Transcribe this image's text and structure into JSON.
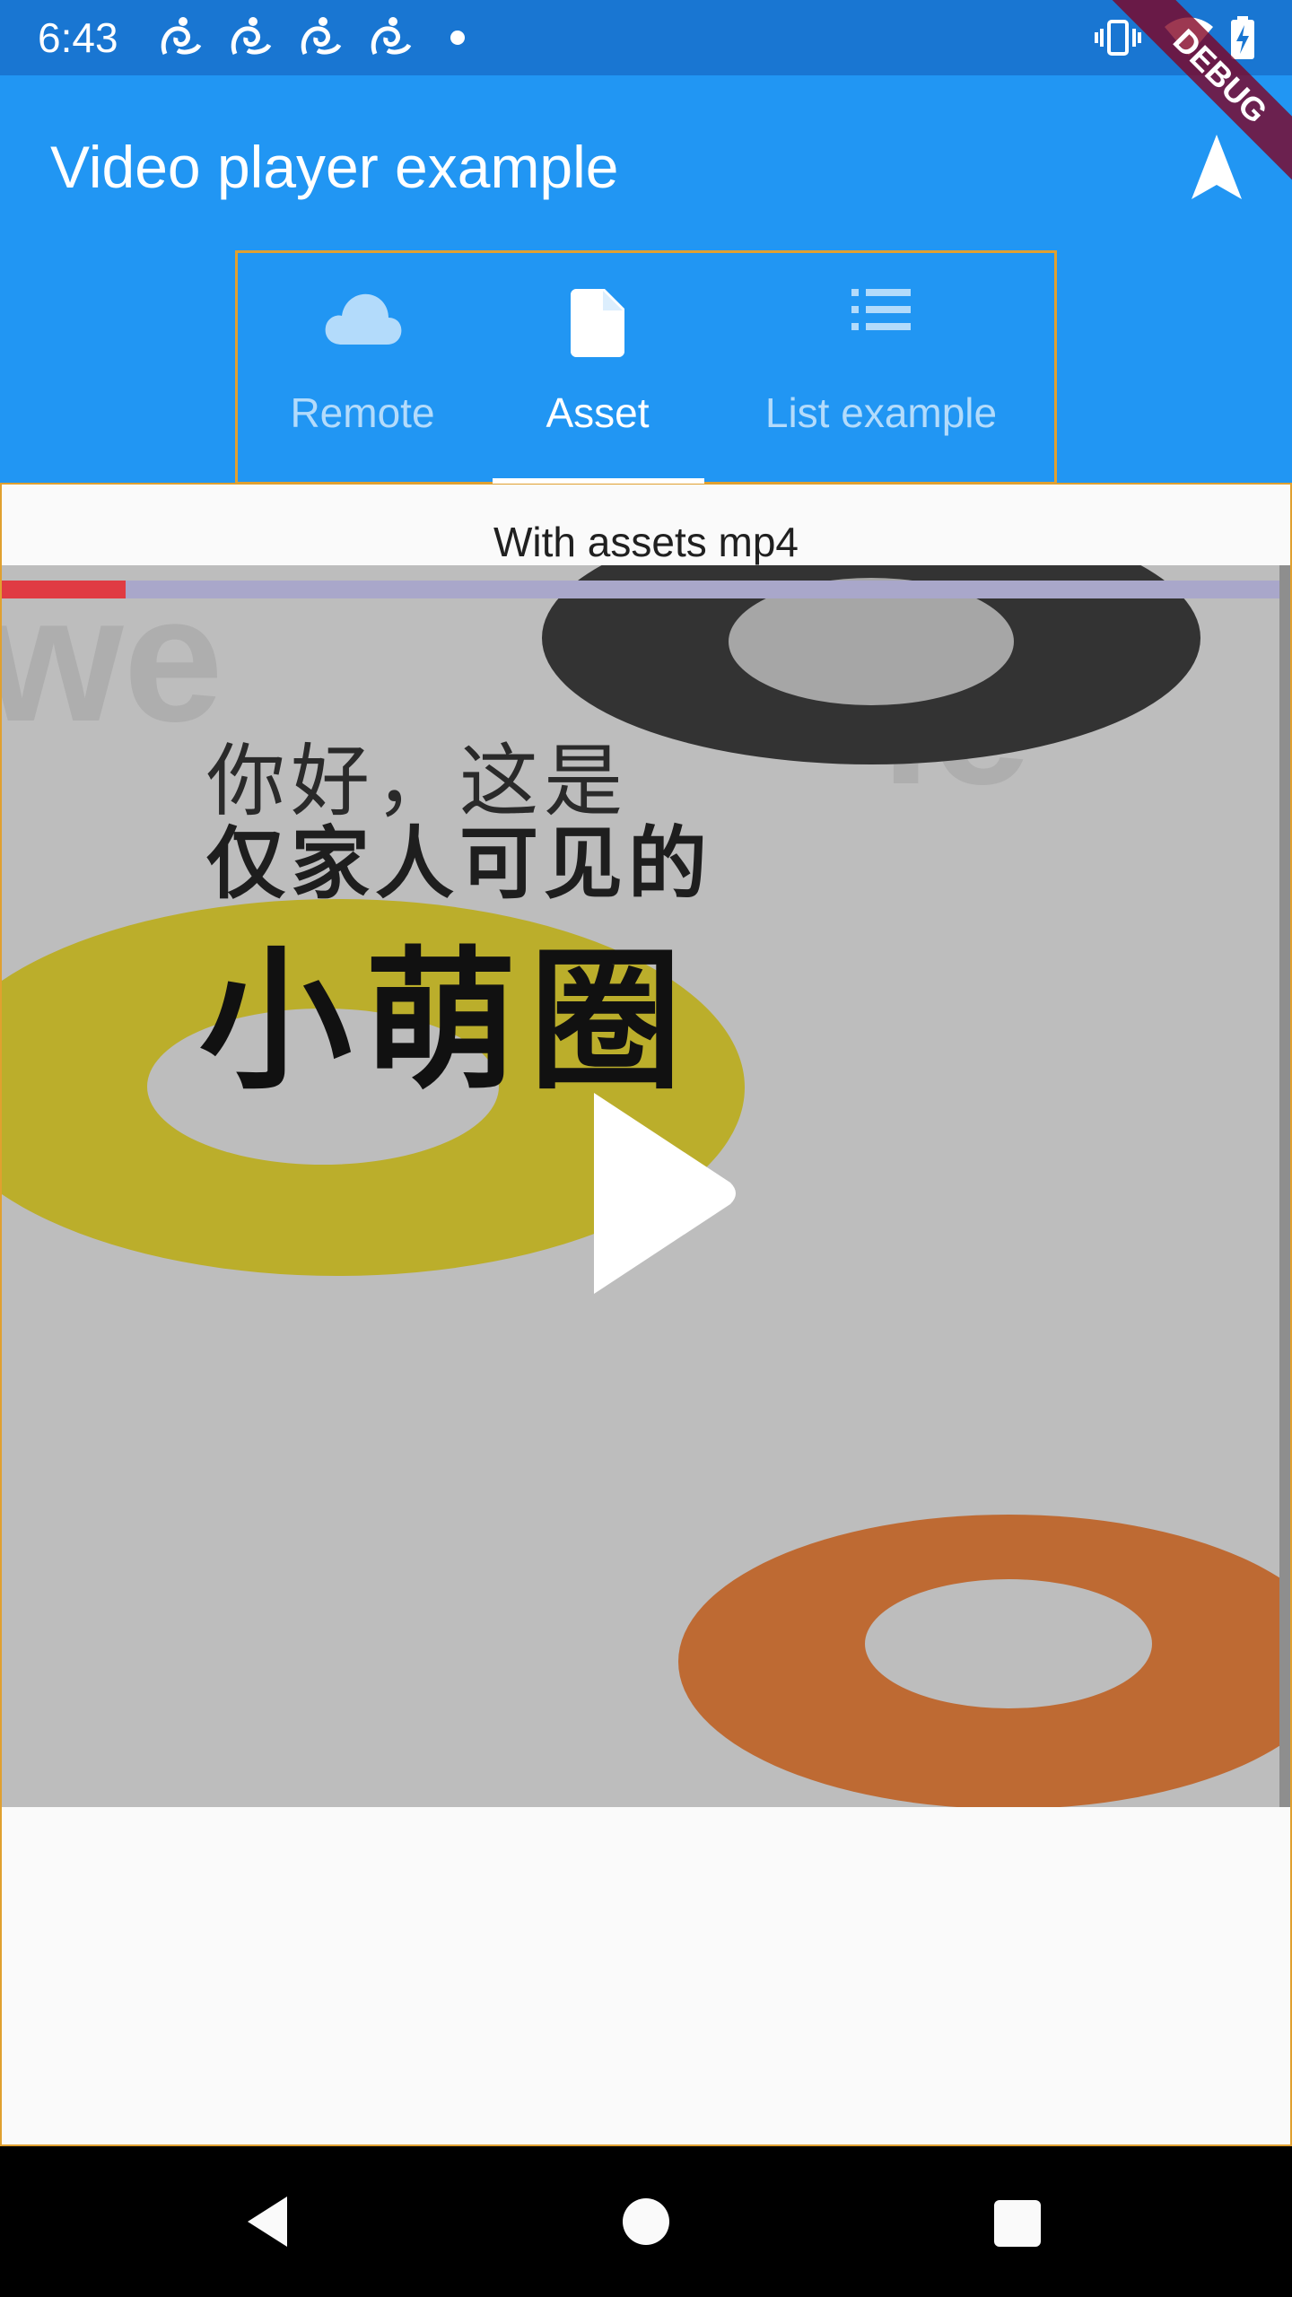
{
  "status_bar": {
    "time": "6:43",
    "notification_icons": [
      "uc-browser-icon",
      "uc-browser-icon",
      "uc-browser-icon",
      "uc-browser-icon"
    ]
  },
  "app_bar": {
    "title": "Video player example",
    "action_icon": "navigation-arrow-icon",
    "background": "#2196F3"
  },
  "tabs": [
    {
      "label": "Remote",
      "icon": "cloud-icon",
      "selected": false
    },
    {
      "label": "Asset",
      "icon": "file-icon",
      "selected": true
    },
    {
      "label": "List example",
      "icon": "list-icon",
      "selected": false
    }
  ],
  "content": {
    "caption": "With assets mp4",
    "video": {
      "progress": 0.097,
      "overlay_text": [
        "你好，这是",
        "仅家人可见的",
        "小萌圈"
      ],
      "play_icon": "play-icon"
    }
  },
  "debug_banner": "DEBUG"
}
